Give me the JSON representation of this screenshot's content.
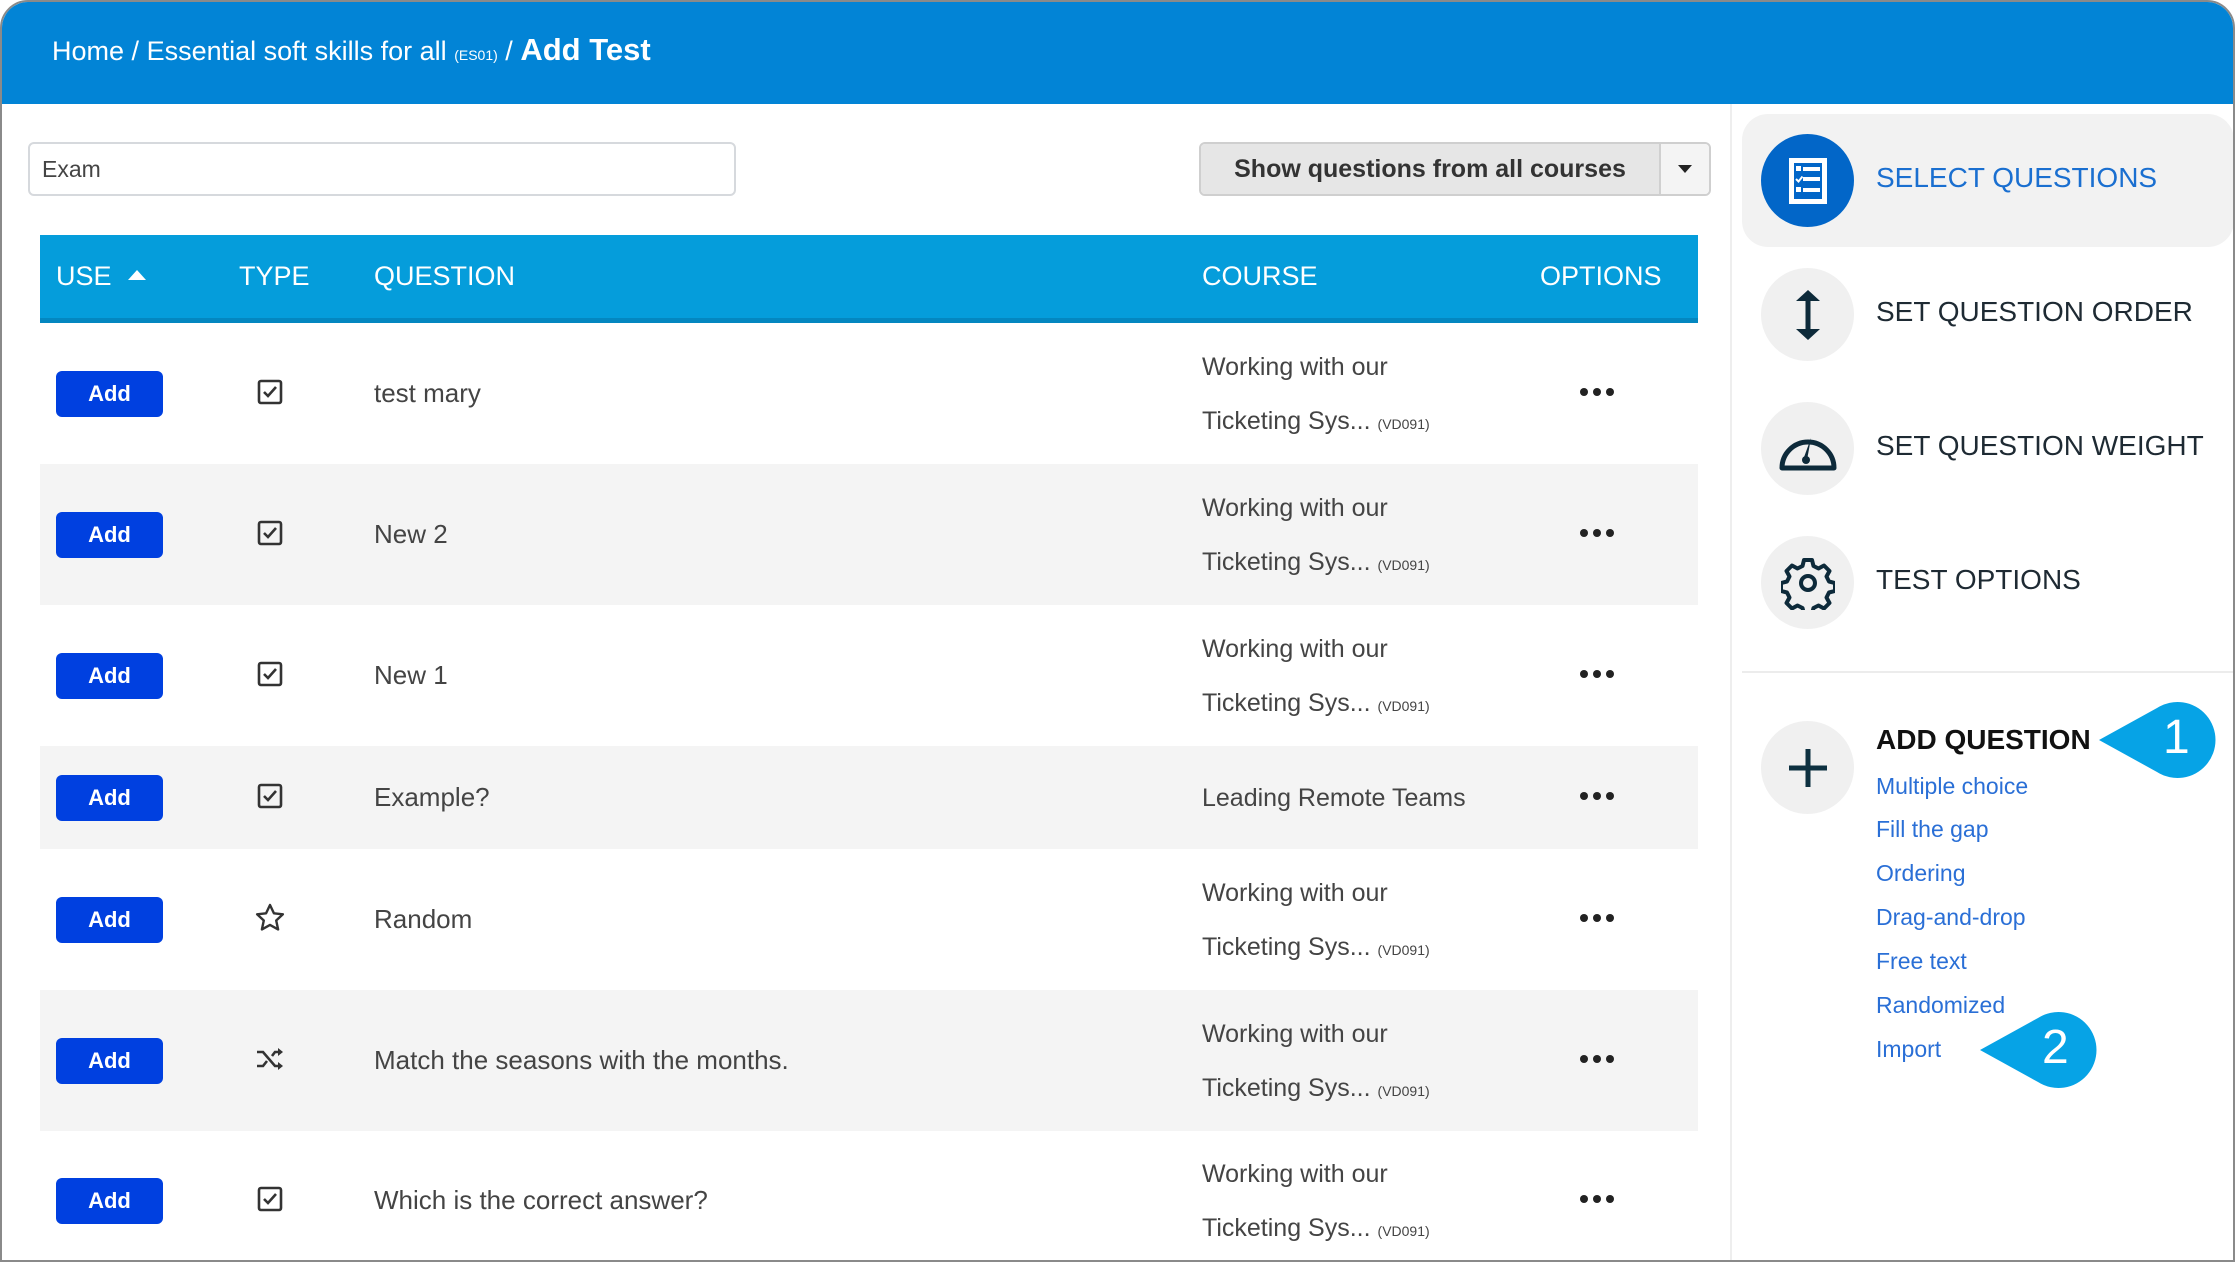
{
  "breadcrumb": {
    "home": "Home",
    "separator": "/",
    "course": "Essential soft skills for all",
    "course_code": "(ES01)",
    "current": "Add Test"
  },
  "search": {
    "value": "Exam"
  },
  "filter": {
    "label": "Show questions from all courses"
  },
  "table": {
    "headers": {
      "use": "USE",
      "type": "TYPE",
      "question": "QUESTION",
      "course": "COURSE",
      "options": "OPTIONS"
    },
    "sort": {
      "column": "USE",
      "direction": "ascending"
    },
    "add_label": "Add",
    "rows": [
      {
        "type_icon": "checkbox-icon",
        "question": "test mary",
        "course_line1": "Working with our",
        "course_line2": "Ticketing Sys...",
        "course_code": "(VD091)"
      },
      {
        "type_icon": "checkbox-icon",
        "question": "New 2",
        "course_line1": "Working with our",
        "course_line2": "Ticketing Sys...",
        "course_code": "(VD091)"
      },
      {
        "type_icon": "checkbox-icon",
        "question": "New 1",
        "course_line1": "Working with our",
        "course_line2": "Ticketing Sys...",
        "course_code": "(VD091)"
      },
      {
        "type_icon": "checkbox-icon",
        "question": "Example?",
        "course_line1": "Leading Remote Teams",
        "course_line2": "",
        "course_code": ""
      },
      {
        "type_icon": "star-icon",
        "question": "Random",
        "course_line1": "Working with our",
        "course_line2": "Ticketing Sys...",
        "course_code": "(VD091)"
      },
      {
        "type_icon": "shuffle-icon",
        "question": "Match the seasons with the months.",
        "course_line1": "Working with our",
        "course_line2": "Ticketing Sys...",
        "course_code": "(VD091)"
      },
      {
        "type_icon": "checkbox-icon",
        "question": "Which is the correct answer?",
        "course_line1": "Working with our",
        "course_line2": "Ticketing Sys...",
        "course_code": "(VD091)"
      }
    ]
  },
  "sidebar": {
    "nav": [
      {
        "label": "SELECT QUESTIONS",
        "icon": "checklist-icon",
        "active": true
      },
      {
        "label": "SET QUESTION ORDER",
        "icon": "vertical-arrows-icon",
        "active": false
      },
      {
        "label": "SET QUESTION WEIGHT",
        "icon": "gauge-icon",
        "active": false
      },
      {
        "label": "TEST OPTIONS",
        "icon": "gear-icon",
        "active": false
      }
    ],
    "add_question": {
      "title": "ADD QUESTION",
      "icon": "plus-icon",
      "links": [
        "Multiple choice",
        "Fill the gap",
        "Ordering",
        "Drag-and-drop",
        "Free text",
        "Randomized",
        "Import"
      ]
    }
  },
  "callouts": [
    "1",
    "2"
  ],
  "colors": {
    "header": "#0284d6",
    "table_header": "#059ddb",
    "add_button": "#0040e0",
    "active_nav": "#1a6fd0",
    "link": "#2a6fd6",
    "callout": "#06a3e6"
  }
}
